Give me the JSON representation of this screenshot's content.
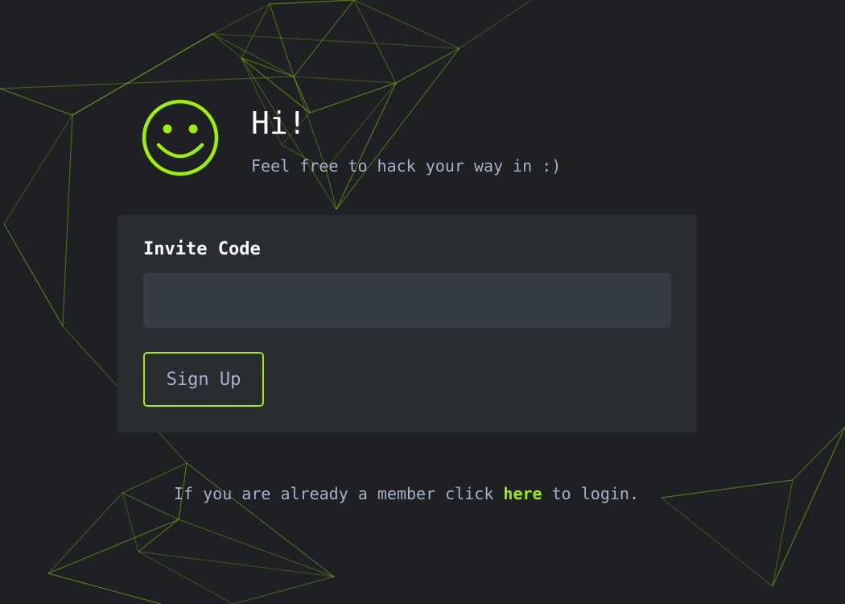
{
  "colors": {
    "background": "#1f2024",
    "card": "#2a2d32",
    "input": "#353c44",
    "accent": "#9fef00",
    "text_primary": "#ffffff",
    "text_muted": "#a4b1cd"
  },
  "header": {
    "icon": "smiley-face-icon",
    "title": "Hi!",
    "subtitle": "Feel free to hack your way in :)"
  },
  "form": {
    "invite_label": "Invite Code",
    "invite_value": "",
    "invite_placeholder": "",
    "submit_label": "Sign Up"
  },
  "footer": {
    "prefix": "If you are already a member click ",
    "link_text": "here",
    "suffix": " to login."
  }
}
